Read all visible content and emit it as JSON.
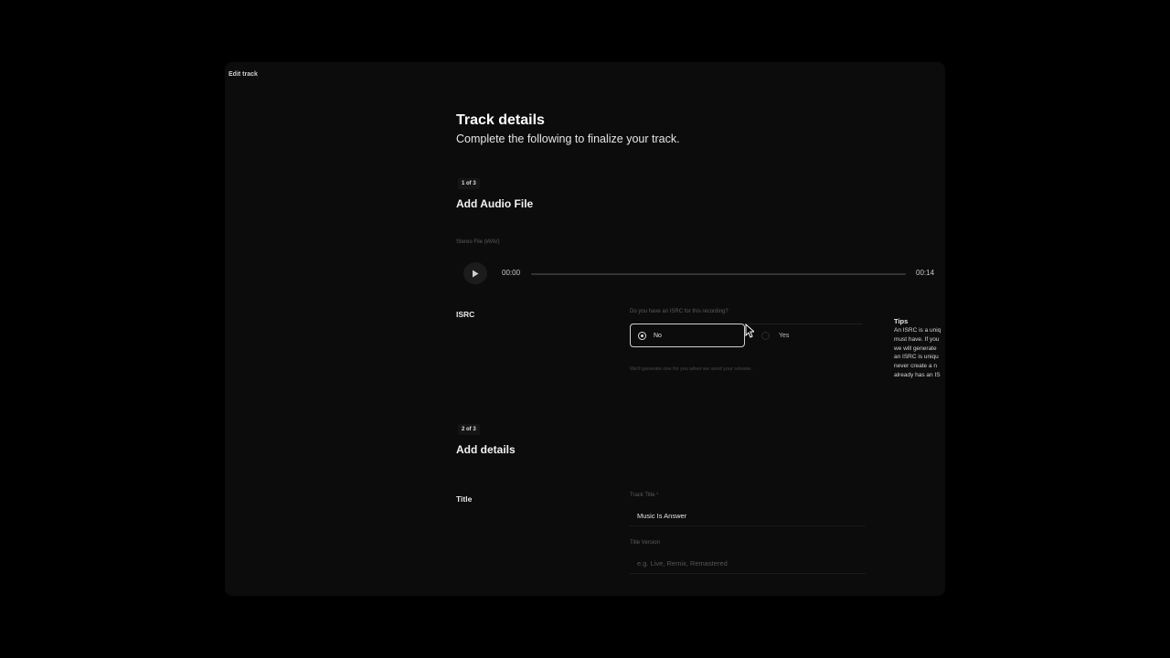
{
  "window": {
    "title": "Edit track"
  },
  "header": {
    "title": "Track details",
    "subtitle": "Complete the following to finalize your track."
  },
  "step1": {
    "badge": "1 of 3",
    "title": "Add Audio File",
    "file_caption": "Stereo File (WAV)",
    "player": {
      "current_time": "00:00",
      "duration": "00:14",
      "progress_fraction": 0
    }
  },
  "isrc": {
    "label": "ISRC",
    "question": "Do you have an ISRC for this recording?",
    "options": [
      {
        "label": "No",
        "selected": true
      },
      {
        "label": "Yes",
        "selected": false
      }
    ],
    "helper": "We'll generate one for you when we send your release."
  },
  "tips": {
    "title": "Tips",
    "lines": [
      "An ISRC is a uniq",
      "must have. If you",
      "we will generate",
      "an ISRC is uniqu",
      "never create a n",
      "already has an IS"
    ]
  },
  "step2": {
    "badge": "2 of 3",
    "title": "Add details",
    "title_row": {
      "label": "Title",
      "track_title_caption": "Track Title",
      "required_mark": "*",
      "track_title_value": "Music Is Answer",
      "version_caption": "Title Version",
      "version_placeholder": "e.g. Live, Remix, Remastered"
    }
  },
  "colors": {
    "background": "#000000",
    "panel": "#0c0c0c",
    "accent": "#ffffff",
    "muted_text": "#5c5c5c"
  },
  "icons": {
    "play": "play-icon",
    "cursor": "mouse-pointer-icon"
  }
}
